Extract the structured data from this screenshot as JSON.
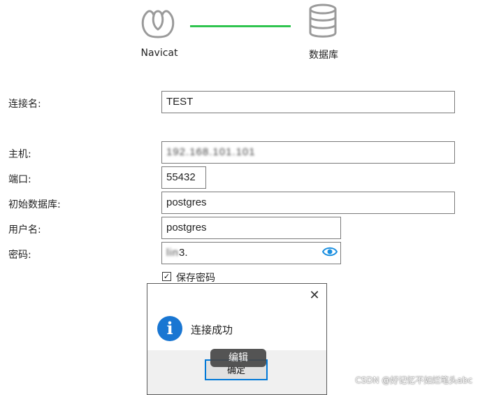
{
  "diagram": {
    "left_label": "Navicat",
    "right_label": "数据库",
    "left_icon": "navicat-logo-icon",
    "right_icon": "database-icon",
    "line_color": "#2fc44f"
  },
  "form": {
    "connection_name": {
      "label": "连接名:",
      "value": "TEST"
    },
    "host": {
      "label": "主机:",
      "value": "192.168.101.101"
    },
    "port": {
      "label": "端口:",
      "value": "55432"
    },
    "initial_database": {
      "label": "初始数据库:",
      "value": "postgres"
    },
    "username": {
      "label": "用户名:",
      "value": "postgres"
    },
    "password": {
      "label": "密码:",
      "value_masked": "lin",
      "value_tail": "3."
    },
    "save_password": {
      "label": "保存密码",
      "checked": true
    }
  },
  "dialog": {
    "message": "连接成功",
    "ok_label": "确定",
    "icon": "info-icon",
    "close_icon": "close-icon"
  },
  "tooltip": {
    "label": "编辑"
  },
  "watermark": "CSDN @好记忆不如烂笔头abc",
  "colors": {
    "accent": "#0078d7",
    "info": "#1976d2",
    "eye": "#1a8fe0"
  }
}
